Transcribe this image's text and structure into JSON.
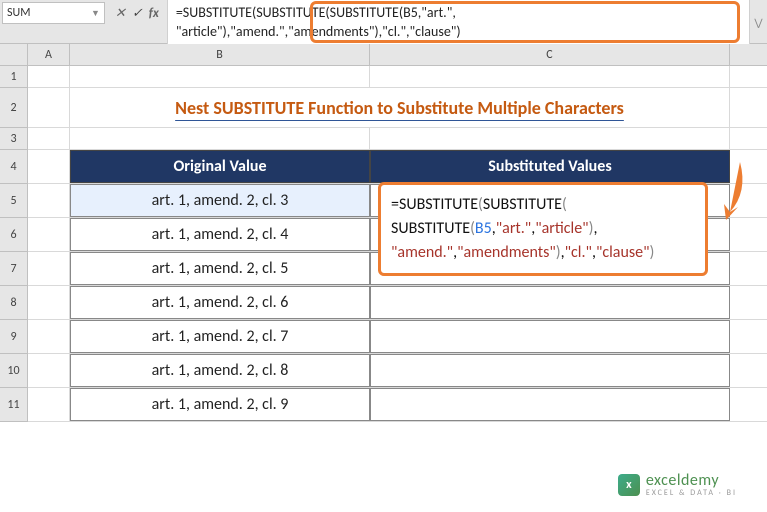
{
  "formula_bar": {
    "name_box": "SUM",
    "formula_line1": "=SUBSTITUTE(SUBSTITUTE(SUBSTITUTE(B5,\"art.\",",
    "formula_line2": "\"article\"),\"amend.\",\"amendments\"),\"cl.\",\"clause\")"
  },
  "columns": {
    "A": "A",
    "B": "B",
    "C": "C"
  },
  "rows": {
    "r1": "1",
    "r2": "2",
    "r3": "3",
    "r4": "4",
    "r5": "5",
    "r6": "6",
    "r7": "7",
    "r8": "8",
    "r9": "9",
    "r10": "10",
    "r11": "11"
  },
  "title": "Nest SUBSTITUTE Function to Substitute Multiple Characters",
  "headers": {
    "original": "Original Value",
    "substituted": "Substituted Values"
  },
  "data": {
    "b5": "art. 1, amend. 2, cl. 3",
    "b6": "art. 1, amend. 2, cl. 4",
    "b7": "art. 1, amend. 2, cl. 5",
    "b8": "art. 1, amend. 2, cl. 6",
    "b9": "art. 1, amend. 2, cl. 7",
    "b10": "art. 1, amend. 2, cl. 8",
    "b11": "art. 1, amend. 2, cl. 9"
  },
  "callout": {
    "eq": "=",
    "sub": "SUBSTITUTE",
    "po": "(",
    "pc": ")",
    "ref": "B5",
    "c": ",",
    "s_art": "\"art.\"",
    "s_article": "\"article\"",
    "s_amend": "\"amend.\"",
    "s_amendments": "\"amendments\"",
    "s_cl": "\"cl.\"",
    "s_clause": "\"clause\""
  },
  "watermark": {
    "logo": "x",
    "text": "exceldemy",
    "sub": "EXCEL & DATA · BI"
  }
}
